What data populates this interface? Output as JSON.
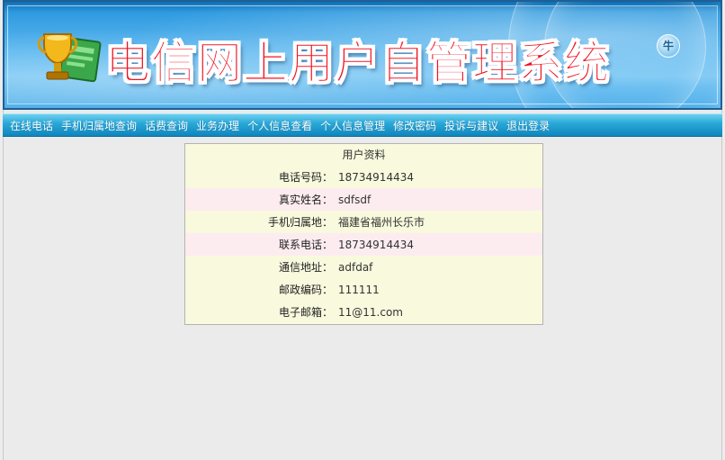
{
  "header": {
    "title": "电信网上用户自管理系统",
    "badge_text": "牛"
  },
  "nav": {
    "items": [
      {
        "label": "在线电话"
      },
      {
        "label": "手机归属地查询"
      },
      {
        "label": "话费查询"
      },
      {
        "label": "业务办理"
      },
      {
        "label": "个人信息查看"
      },
      {
        "label": "个人信息管理"
      },
      {
        "label": "修改密码"
      },
      {
        "label": "投诉与建议"
      },
      {
        "label": "退出登录"
      }
    ]
  },
  "profile": {
    "title": "用户资料",
    "rows": [
      {
        "label": "电话号码：",
        "value": "18734914434"
      },
      {
        "label": "真实姓名：",
        "value": "sdfsdf"
      },
      {
        "label": "手机归属地：",
        "value": "福建省福州长乐市"
      },
      {
        "label": "联系电话：",
        "value": "18734914434"
      },
      {
        "label": "通信地址：",
        "value": "adfdaf"
      },
      {
        "label": "邮政编码：",
        "value": "111111"
      },
      {
        "label": "电子邮箱：",
        "value": "11@11.com"
      }
    ]
  },
  "colors": {
    "title_red": "#f01020",
    "nav_blue": "#1b96cc",
    "table_bg": "#f8f9dd",
    "table_alt_row": "#fcecf0"
  }
}
